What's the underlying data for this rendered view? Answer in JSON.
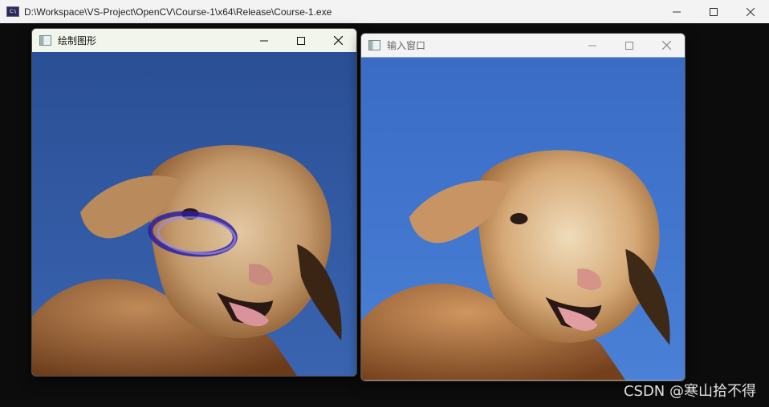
{
  "console": {
    "title": "D:\\Workspace\\VS-Project\\OpenCV\\Course-1\\x64\\Release\\Course-1.exe",
    "icon_label": "C:\\"
  },
  "windows": [
    {
      "title": "绘制图形",
      "state": "active",
      "has_ellipse": true,
      "ellipse_color": "#3a2aa8"
    },
    {
      "title": "输入窗口",
      "state": "inactive",
      "has_ellipse": false
    }
  ],
  "image": {
    "subject": "lamb-photo",
    "sky_colors": [
      "#3e6ec8",
      "#2b5aa8"
    ],
    "fur_colors": [
      "#d8b890",
      "#a66b3a",
      "#6e3e1e"
    ]
  },
  "watermark": "CSDN @寒山拾不得"
}
